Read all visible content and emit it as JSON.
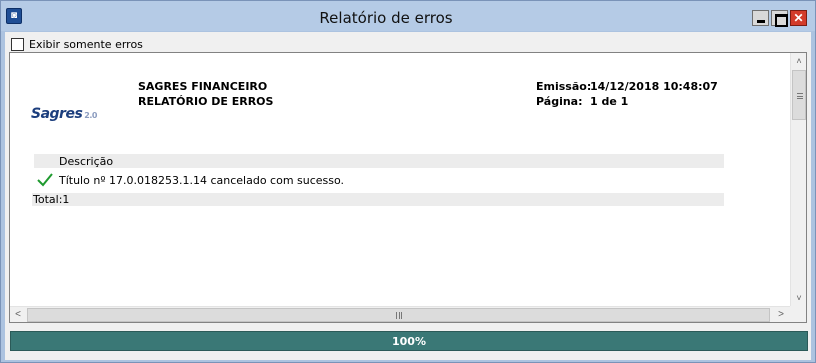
{
  "window": {
    "title": "Relatório de erros",
    "icon": "app-icon",
    "controls": {
      "minimize": "minimize-icon",
      "maximize": "maximize-icon",
      "close": "✕"
    }
  },
  "filter": {
    "show_errors_only_label": "Exibir somente erros",
    "checked": false
  },
  "report": {
    "logo_text": "Sagres",
    "logo_version": "2.0",
    "company": "SAGRES FINANCEIRO",
    "report_name": "RELATÓRIO DE ERROS",
    "issued_label": "Emissão:",
    "issued_value": "14/12/2018 10:48:07",
    "page_label": "Página:",
    "page_value": "1 de 1",
    "column_header": "Descrição",
    "rows": [
      {
        "status_icon": "success-check-icon",
        "text": "Título nº 17.0.018253.1.14 cancelado com sucesso."
      }
    ],
    "total_label": "Total:1"
  },
  "scrollbars": {
    "up": "˄",
    "down": "˅",
    "left": "<",
    "right": ">"
  },
  "progress": {
    "fraction": 1.0,
    "label": "100%",
    "color": "#3a7876"
  }
}
